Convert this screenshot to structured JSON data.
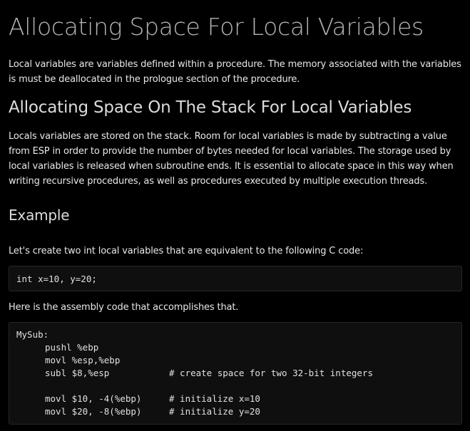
{
  "title": "Allocating Space For Local Variables",
  "intro": "Local variables are variables defined within a procedure. The memory associated with the variables is must be deallocated in the prologue section of the procedure.",
  "section_stack": {
    "heading": "Allocating Space On The Stack For Local Variables",
    "body": "Locals variables are stored on the stack. Room for local variables is made by subtracting a value from ESP in order to provide the number of bytes needed for local variables. The storage used by local variables is released when subroutine ends. It is essential to allocate space in this way when writing recursive procedures, as well as procedures executed by multiple execution threads."
  },
  "section_example": {
    "heading": "Example",
    "lead": "Let's create two int local variables that are equivalent to the following C code:",
    "c_code": "int x=10, y=20;",
    "assembly_lead": "Here is the assembly code that accomplishes that.",
    "asm": {
      "label": "MySub:",
      "lines": [
        {
          "instr": "pushl %ebp",
          "comment": ""
        },
        {
          "instr": "movl %esp,%ebp",
          "comment": ""
        },
        {
          "instr": "subl $8,%esp",
          "comment": "# create space for two 32-bit integers"
        },
        {
          "instr": "",
          "comment": ""
        },
        {
          "instr": "movl $10, -4(%ebp)",
          "comment": "# initialize x=10"
        },
        {
          "instr": "movl $20, -8(%ebp)",
          "comment": "# initialize y=20"
        }
      ]
    }
  }
}
